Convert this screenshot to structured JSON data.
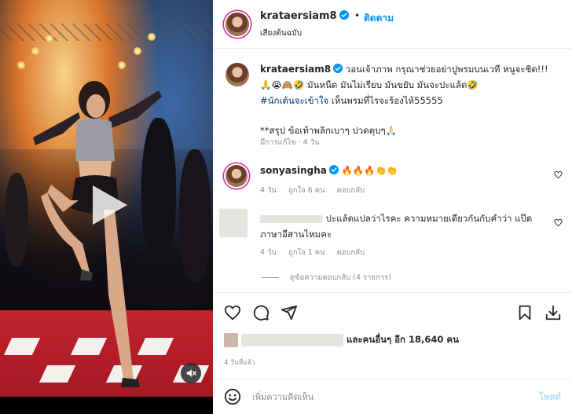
{
  "post": {
    "username": "krataersiam8",
    "follow_label": "ติดตาม",
    "dot": "•",
    "audio_label": "เสียงต้นฉบับ",
    "caption_line1": "วอนเจ้าภาพ กรุณาช่วยอย่าปูพรมบนเวที หนูจะชิด!!!",
    "caption_line2": "🙏😭🙈🤣 มันหนืด มันไม่เรียบ มันขยับ มันจะปะแล้ด🤣",
    "caption_hashtag": "#นักเต้นจะเข้าใจ",
    "caption_line3_rest": " เห็นพรมที่ไรจะร้องไห้55555",
    "caption_line4": "**สรุป ข้อเท้าพลิกเบาๆ ปวดตุบๆ🙏🏻",
    "caption_meta": "มีการแก้ไข · 4 วัน",
    "likes_text": "และคนอื่นๆ อีก 18,640 คน",
    "post_time": "4 วันที่แล้ว"
  },
  "comments": [
    {
      "username": "sonyasingha",
      "text": "🔥🔥🔥👏👏",
      "time": "4 วัน",
      "likes": "ถูกใจ 6 คน",
      "reply_label": "ตอบกลับ"
    },
    {
      "username": "",
      "text_line1": "ปะแล้ดแปลว่าไรคะ ความหมายเดียวกันกับคำว่า แป๊ด",
      "text_line2": "ภาษาอีสานไหมคะ",
      "time": "4 วัน",
      "likes": "ถูกใจ 1 คน",
      "reply_label": "ตอบกลับ",
      "view_replies": "ดูข้อความตอบกลับ (4 รายการ)"
    }
  ],
  "comment_box": {
    "placeholder": "เพิ่มความคิดเห็น",
    "post_label": "โพสต์"
  },
  "icons": {
    "like": "heart-icon",
    "comment": "comment-icon",
    "share": "share-icon",
    "save": "bookmark-icon",
    "download": "download-icon",
    "emoji": "emoji-icon",
    "play": "play-icon",
    "mute": "mute-icon",
    "verified": "verified-badge-icon"
  },
  "colors": {
    "accent": "#0095f6",
    "hashtag": "#00376b",
    "muted": "#8e8e8e",
    "verified": "#0095f6"
  }
}
